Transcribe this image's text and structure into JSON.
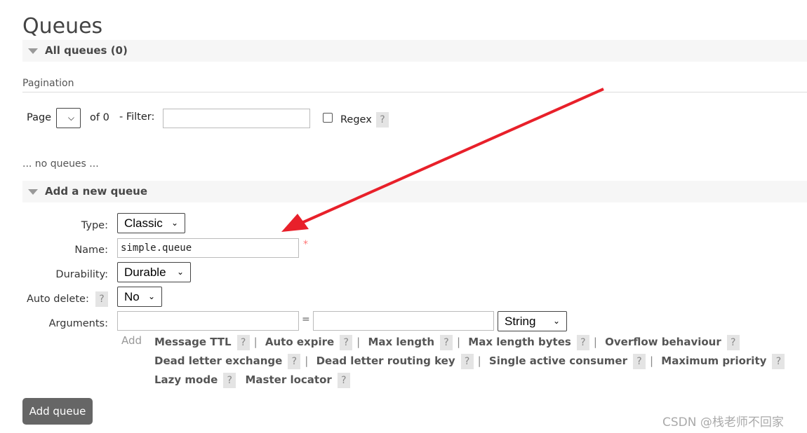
{
  "page_title": "Queues",
  "all_queues": {
    "label": "All queues (0)"
  },
  "pagination": {
    "heading": "Pagination",
    "page_label": "Page",
    "of_label": "of 0",
    "filter_label": "- Filter:",
    "filter_value": "",
    "regex_label": "Regex",
    "help": "?"
  },
  "empty_text": "... no queues ...",
  "add_queue": {
    "label": "Add a new queue",
    "type_label": "Type:",
    "type_value": "Classic",
    "name_label": "Name:",
    "name_value": "simple.queue",
    "required": "*",
    "durability_label": "Durability:",
    "durability_value": "Durable",
    "auto_delete_label": "Auto delete:",
    "auto_delete_value": "No",
    "arguments_label": "Arguments:",
    "equals": "=",
    "arg_type": "String",
    "add_link": "Add",
    "args": [
      "Message TTL",
      "Auto expire",
      "Max length",
      "Max length bytes",
      "Overflow behaviour",
      "Dead letter exchange",
      "Dead letter routing key",
      "Single active consumer",
      "Maximum priority",
      "Lazy mode",
      "Master locator"
    ],
    "submit": "Add queue"
  },
  "watermark": "CSDN @栈老师不回家",
  "colors": {
    "arrow": "#e8202a",
    "button": "#666666"
  }
}
